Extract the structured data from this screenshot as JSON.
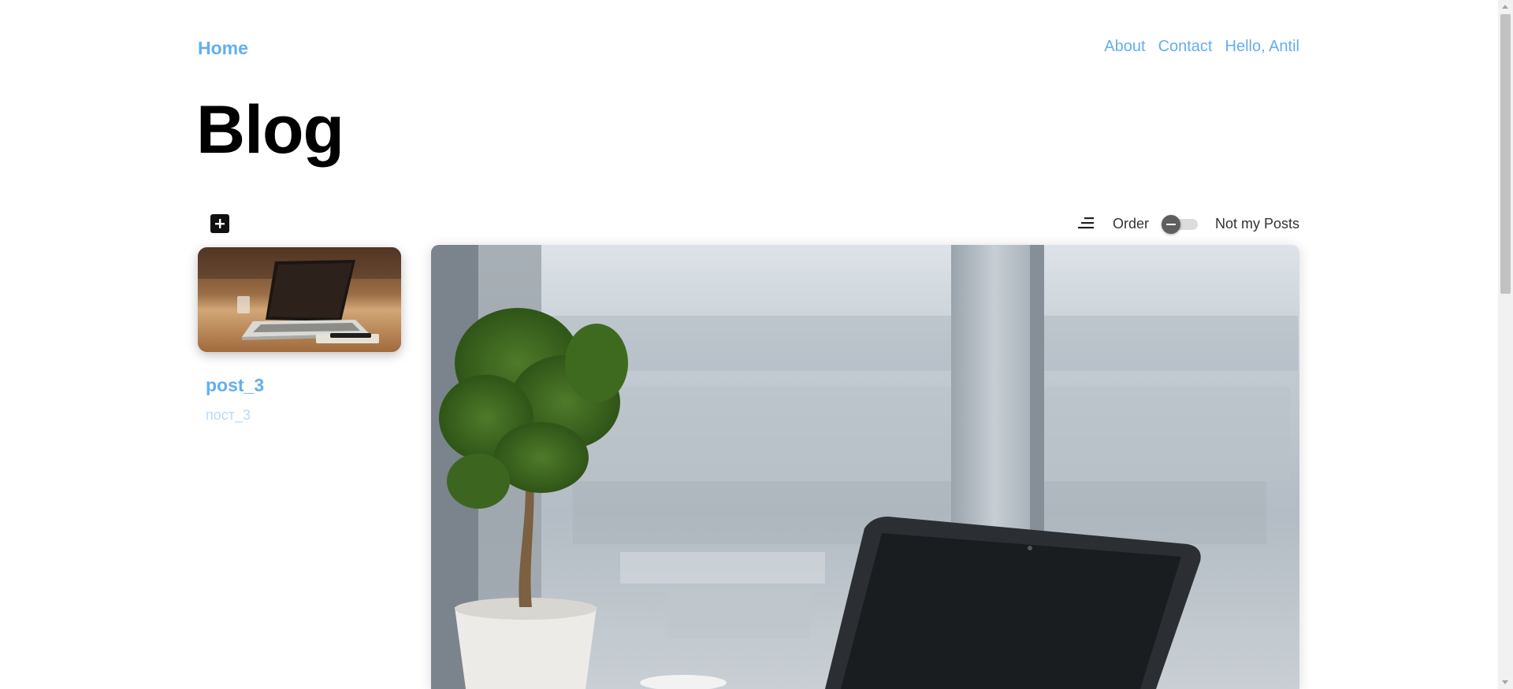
{
  "nav": {
    "home": "Home",
    "links": [
      "About",
      "Contact",
      "Hello, Antil"
    ]
  },
  "page": {
    "title": "Blog"
  },
  "toolbar": {
    "add_icon": "plus-square-icon",
    "sort_icon": "sort-descending-icon",
    "order_label": "Order",
    "order_toggle_on": false,
    "filter_label": "Not my Posts"
  },
  "posts": [
    {
      "title": "post_3",
      "subtitle": "пост_3",
      "thumbnail": "laptop-on-desk-photo"
    }
  ],
  "hero": {
    "image": "laptop-plant-office-window-photo"
  },
  "colors": {
    "link": "#63aef0",
    "subtitle": "#b8dbf8",
    "title": "#000000",
    "toggle_knob": "#5e5e5e"
  }
}
